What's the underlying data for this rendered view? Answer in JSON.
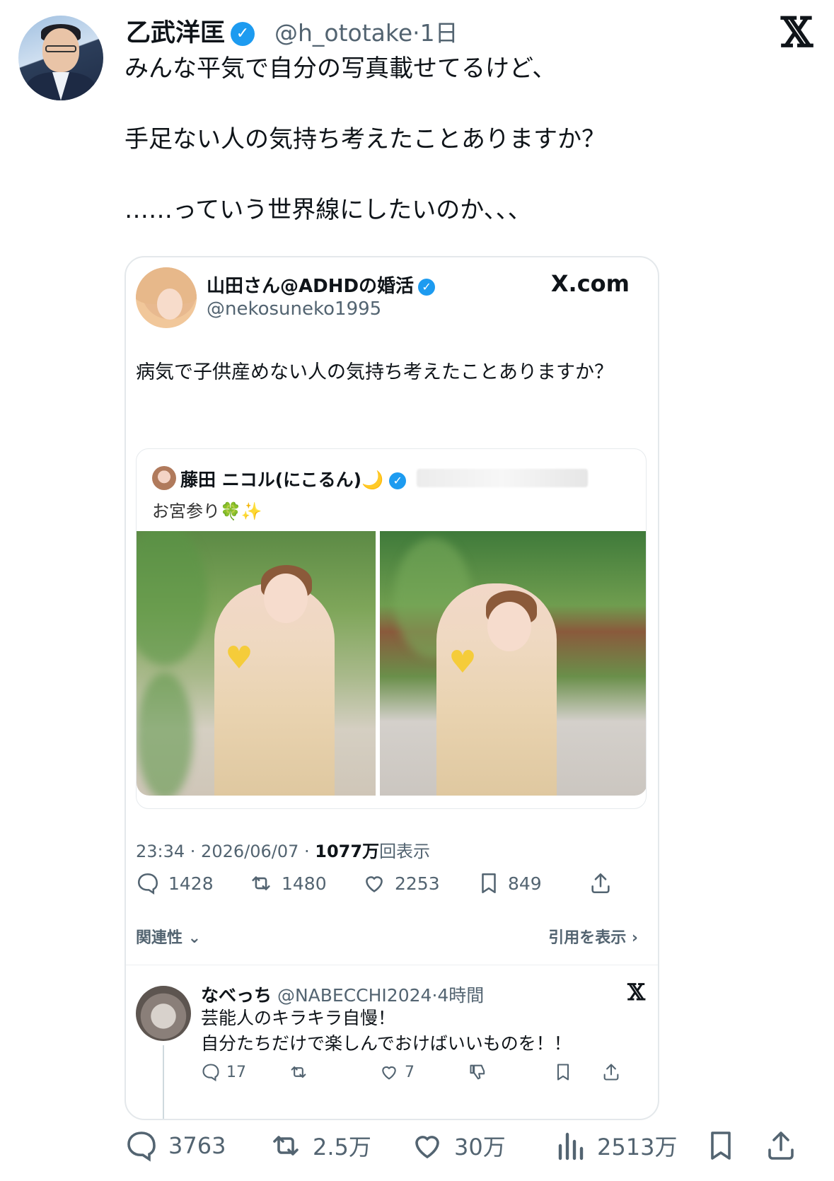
{
  "author": {
    "name": "乙武洋匡",
    "handle": "@h_ototake",
    "time": "1日"
  },
  "tweet": {
    "text": "みんな平気で自分の写真載せてるけど、\n\n手足ない人の気持ち考えたことありますか？\n\n……っていう世界線にしたいのか、、、"
  },
  "quote": {
    "name": "山田さん@ADHDの婚活",
    "handle": "@nekosuneko1995",
    "source": "X.com",
    "text": "病気で子供産めない人の気持ち考えたことありますか？",
    "embedded": {
      "name": "藤田 ニコル(にこるん)🌙",
      "text": "お宮参り🍀✨"
    },
    "meta_time": "23:34 · 2026/06/07 · ",
    "meta_views": "1077万",
    "meta_views_suffix": "回表示",
    "stats": {
      "replies": "1428",
      "reposts": "1480",
      "likes": "2253",
      "bookmarks": "849"
    },
    "relevance_label": "関連性",
    "show_quotes_label": "引用を表示"
  },
  "reply": {
    "name": "なべっち",
    "handle": "@NABECCHI2024",
    "time": "·4時間",
    "text": "芸能人のキラキラ自慢！\n自分たちだけで楽しんでおけばいいものを！！",
    "stats": {
      "replies": "17",
      "likes": "7"
    }
  },
  "stats": {
    "replies": "3763",
    "reposts": "2.5万",
    "likes": "30万",
    "views": "2513万"
  },
  "colors": {
    "accent": "#1d9bf0",
    "muted": "#536471",
    "text": "#0f1419"
  }
}
